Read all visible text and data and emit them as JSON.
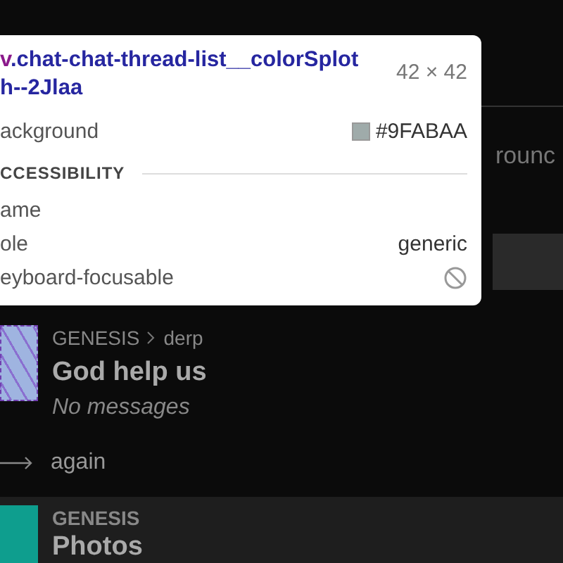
{
  "background_field": {
    "value": "rounc"
  },
  "inspector_tooltip": {
    "selector_tag": "v",
    "selector_lines": [
      ".chat-chat-thread-list__colorSplot",
      "h--2Jlaa"
    ],
    "size": "42 × 42",
    "background": {
      "label": "ackground",
      "value": "#9FABAA"
    },
    "section_title": "CCESSIBILITY",
    "properties": [
      {
        "label": "ame",
        "kind": "text"
      },
      {
        "label": "ole",
        "kind": "text",
        "value": "generic"
      },
      {
        "label": "eyboard-focusable",
        "kind": "flag",
        "on": false
      }
    ]
  },
  "threads": [
    {
      "color": "#9fb4e0",
      "highlighted": true,
      "group": "GENESIS",
      "channel": "derp",
      "title": "God help us",
      "preview": "No messages",
      "selected": false
    },
    {
      "kind": "link",
      "label": "again"
    },
    {
      "color": "#0e9e8e",
      "highlighted": false,
      "group": "GENESIS",
      "title": "Photos",
      "selected": true
    }
  ]
}
